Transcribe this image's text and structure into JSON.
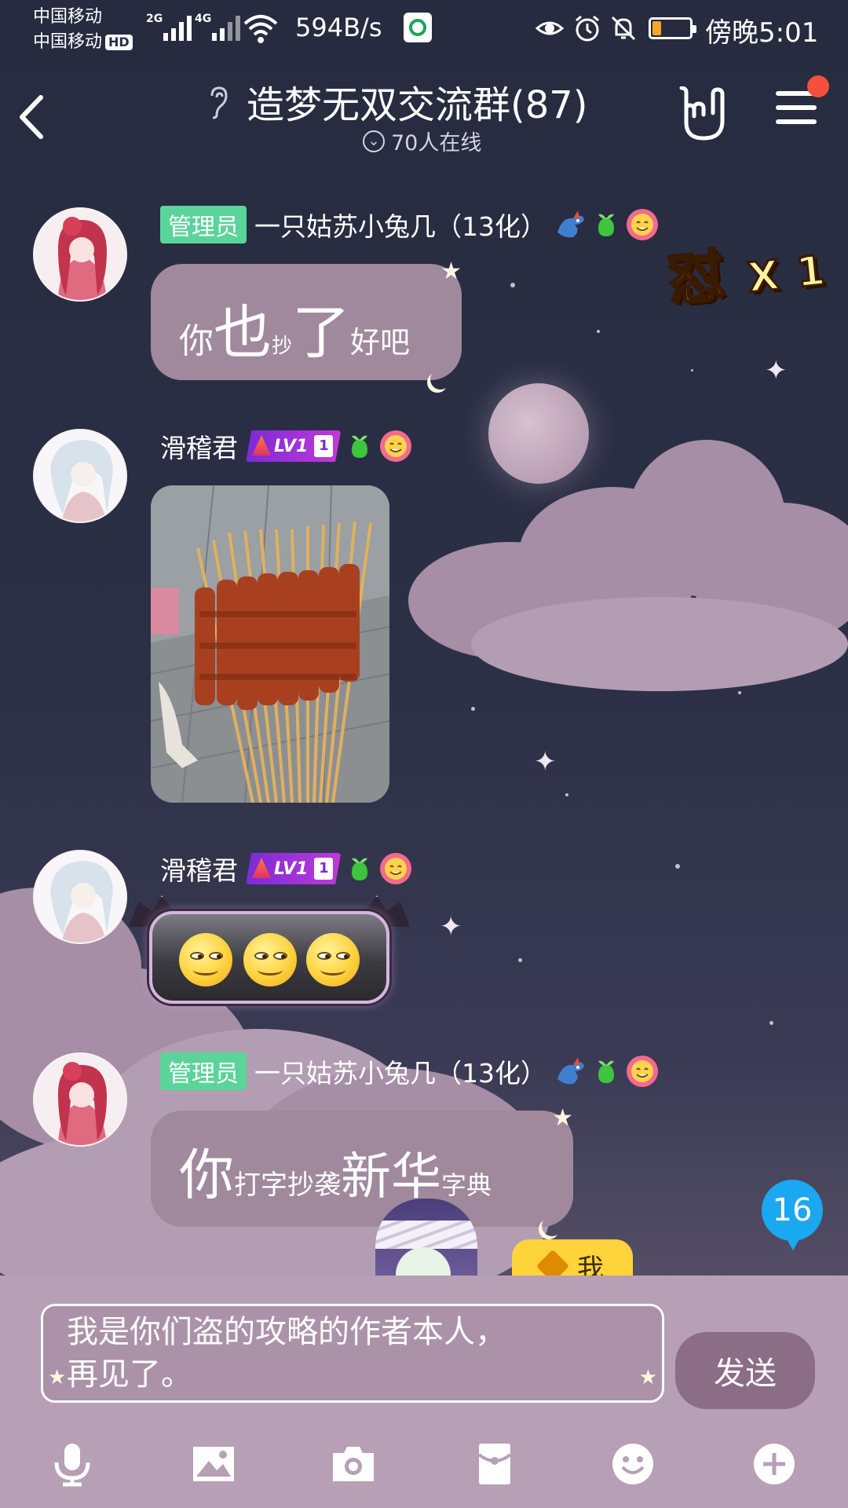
{
  "status_bar": {
    "carrier_1": "中国移动",
    "carrier_2": "中国移动",
    "hd_badge": "HD",
    "net_2g": "2G",
    "net_4g": "4G",
    "net_speed": "594B/s",
    "time": "傍晚5:01",
    "battery_level": 0.22,
    "battery_color": "#f5a623"
  },
  "header": {
    "title": "造梦无双交流群(87)",
    "online_text": "70人在线",
    "icons": [
      "back-arrow-icon",
      "ear-icon",
      "rock-hand-icon",
      "menu-icon"
    ]
  },
  "messages": [
    {
      "sender_tag": "管理员",
      "sender_name": "一只姑苏小兔几（13化）",
      "type": "text",
      "segments": [
        {
          "text": "你",
          "size": "small"
        },
        {
          "text": "也",
          "size": "large"
        },
        {
          "text": "抄",
          "size": "tiny"
        },
        {
          "text": "了",
          "size": "large"
        },
        {
          "text": "好吧",
          "size": "small"
        }
      ]
    },
    {
      "sender_name": "滑稽君",
      "level_badge": "LV1",
      "level_num": "1",
      "type": "image",
      "image_description_icon": "meat-skewers-photo"
    },
    {
      "sender_name": "滑稽君",
      "level_badge": "LV1",
      "level_num": "1",
      "type": "emoji",
      "emoji_count": 3
    },
    {
      "sender_tag": "管理员",
      "sender_name": "一只姑苏小兔几（13化）",
      "type": "text",
      "segments": [
        {
          "text": "你",
          "size": "large"
        },
        {
          "text": "打字抄袭",
          "size": "tiny"
        },
        {
          "text": "新华",
          "size": "large"
        },
        {
          "text": "字典",
          "size": "tiny"
        }
      ]
    }
  ],
  "combo": {
    "word": "怼",
    "times": "X 1"
  },
  "unread_count": "16",
  "me_tag": "我",
  "input": {
    "text_line_1": "我是你们盗的攻略的作者本人，",
    "text_line_2": "再见了。",
    "send_label": "发送"
  },
  "toolbar": [
    "microphone-icon",
    "image-icon",
    "camera-icon",
    "red-packet-icon",
    "emoji-icon",
    "plus-icon"
  ],
  "colors": {
    "bubble": "#a0899c",
    "admin_tag": "#5bd49a",
    "input_bg": "#b79fb5",
    "send_button": "#8b6d86",
    "unread": "#1aa8f0"
  }
}
